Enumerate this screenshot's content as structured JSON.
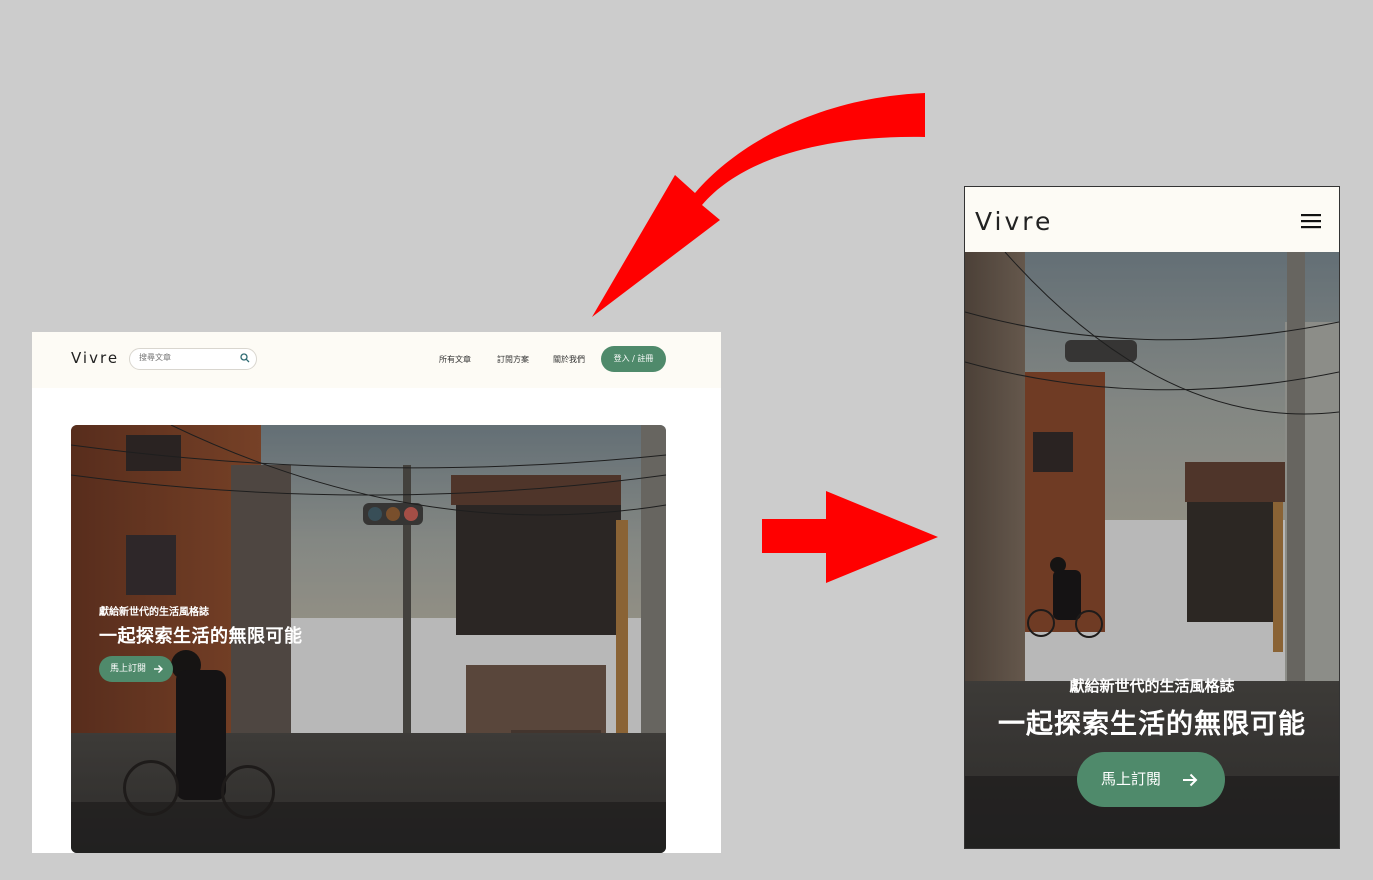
{
  "desktop": {
    "brand": "Vivre",
    "search": {
      "placeholder": "搜尋文章"
    },
    "nav": [
      "所有文章",
      "訂閱方案",
      "關於我們"
    ],
    "login_label": "登入 / 註冊",
    "hero": {
      "subtitle": "獻給新世代的生活風格誌",
      "title": "一起探索生活的無限可能",
      "cta_label": "馬上訂閱"
    }
  },
  "mobile": {
    "brand": "Vivre",
    "hero": {
      "subtitle": "獻給新世代的生活風格誌",
      "title": "一起探索生活的無限可能",
      "cta_label": "馬上訂閱"
    }
  },
  "colors": {
    "background": "#cccccc",
    "accent_green": "#4f8a6b",
    "header_cream": "#fdfbf5",
    "arrow_red": "#ff0000"
  },
  "icons": [
    "search-icon",
    "arrow-right-icon",
    "hamburger-menu-icon",
    "curved-arrow-icon",
    "right-arrow-icon"
  ]
}
